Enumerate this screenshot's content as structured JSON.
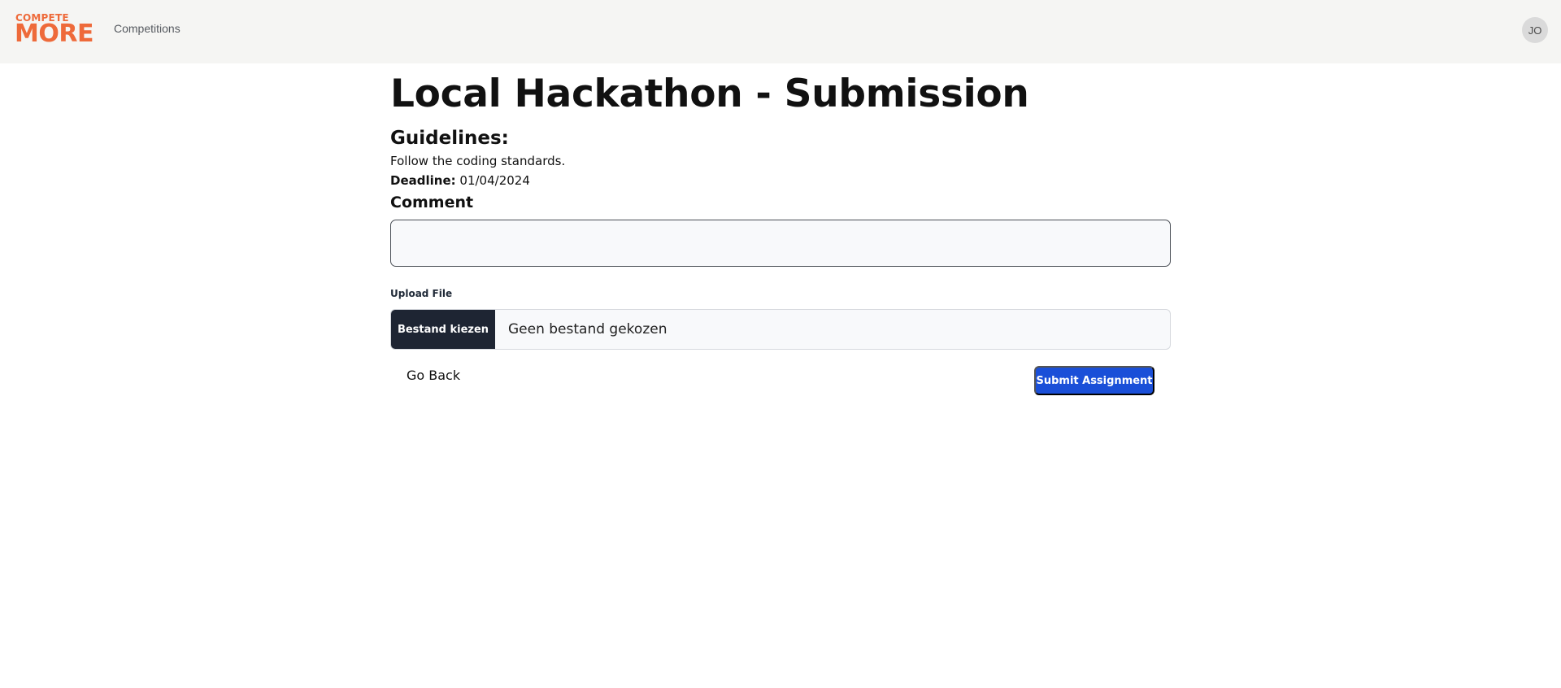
{
  "navbar": {
    "logo": {
      "line1": "COMPETE",
      "line2": "MORE",
      "color": "#ee6a3a"
    },
    "links": [
      {
        "label": "Competitions"
      }
    ],
    "user_initials": "JO"
  },
  "page": {
    "title": "Local Hackathon - Submission",
    "guidelines_heading": "Guidelines:",
    "guidelines_text": "Follow the coding standards.",
    "deadline_label": "Deadline:",
    "deadline_value": "01/04/2024"
  },
  "form": {
    "comment_label": "Comment",
    "comment_value": "",
    "upload_label": "Upload File",
    "file_button_label": "Bestand kiezen",
    "file_status": "Geen bestand gekozen",
    "back_label": "Go Back",
    "submit_label": "Submit Assignment"
  },
  "colors": {
    "brand": "#ee6a3a",
    "primary_button": "#1a4fd8",
    "file_button": "#1e2533",
    "navbar_bg": "#f5f5f3"
  }
}
